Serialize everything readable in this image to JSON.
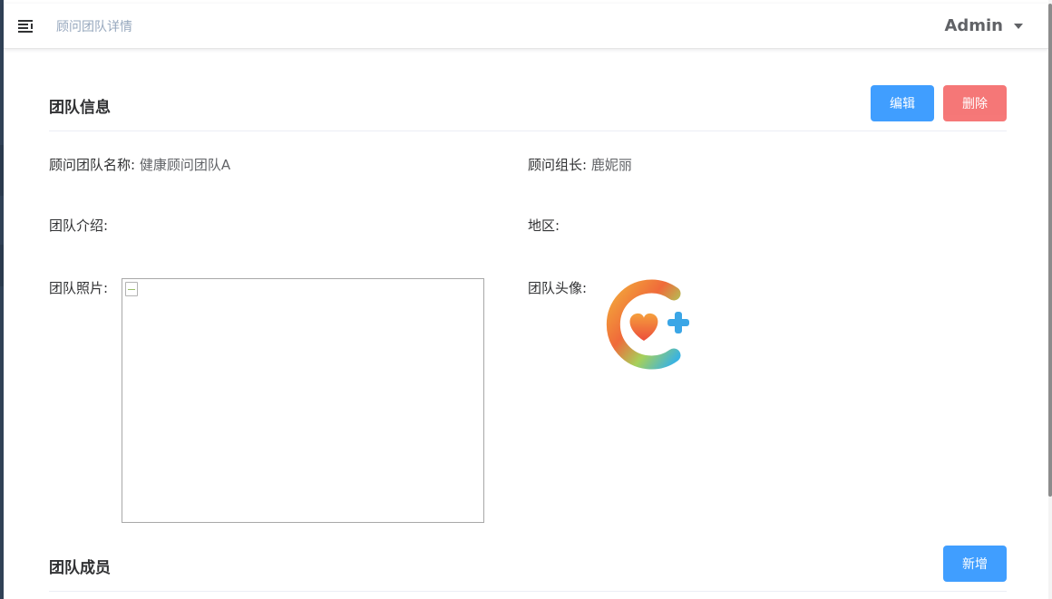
{
  "header": {
    "breadcrumb": "顾问团队详情",
    "user_name": "Admin"
  },
  "team_info": {
    "title": "团队信息",
    "edit_label": "编辑",
    "delete_label": "删除",
    "fields": {
      "name_label": "顾问团队名称:",
      "name_value": "健康顾问团队A",
      "leader_label": "顾问组长:",
      "leader_value": "鹿妮丽",
      "intro_label": "团队介绍:",
      "intro_value": "",
      "region_label": "地区:",
      "region_value": "",
      "photo_label": "团队照片:",
      "avatar_label": "团队头像:"
    }
  },
  "team_members": {
    "title": "团队成员",
    "add_label": "新增"
  },
  "colors": {
    "primary": "#409eff",
    "danger": "#f56c6c",
    "sidebar": "#304156"
  },
  "icons": {
    "menu": "hamburger-fold-icon",
    "dropdown": "caret-down-icon",
    "avatar": "health-logo-heart-plus"
  }
}
